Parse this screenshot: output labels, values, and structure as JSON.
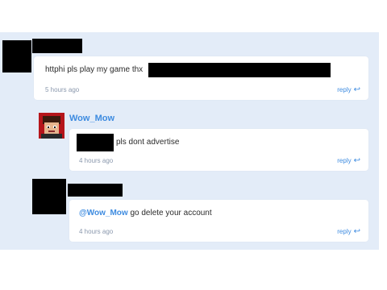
{
  "comments": [
    {
      "message": "httphi pls play my game thx",
      "time": "5 hours ago",
      "reply_label": "reply"
    },
    {
      "username": "Wow_Mow",
      "message": "pls dont advertise",
      "time": "4 hours ago",
      "reply_label": "reply"
    },
    {
      "mention": "@Wow_Mow",
      "message": "go delete your account",
      "time": "4 hours ago",
      "reply_label": "reply"
    }
  ],
  "colors": {
    "accent": "#3d8be0",
    "thread_bg": "#e3ecf8",
    "redaction": "#000000"
  },
  "icons": {
    "reply": "reply-arrow-icon"
  }
}
